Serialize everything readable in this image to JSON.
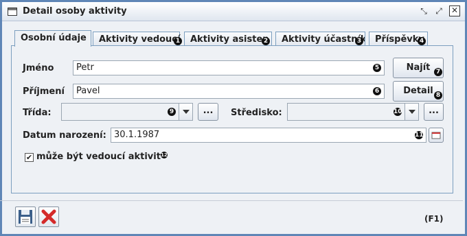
{
  "window": {
    "title": "Detail osoby aktivity",
    "minimize_glyph": "⤡",
    "maximize_glyph": "⤢",
    "close_glyph": "✕"
  },
  "tabs": [
    {
      "label": "Osobní údaje",
      "badge": ""
    },
    {
      "label": "Aktivity vedoucí",
      "badge": "1"
    },
    {
      "label": "Aktivity asisten",
      "badge": "2"
    },
    {
      "label": "Aktivity účastník",
      "badge": "3"
    },
    {
      "label": "Příspěvky",
      "badge": "4"
    }
  ],
  "form": {
    "jmeno_label": "Jméno",
    "jmeno_value": "Petr",
    "jmeno_badge": "5",
    "najit_label": "Najít",
    "najit_badge": "7",
    "prijmeni_label": "Příjmení",
    "prijmeni_value": "Pavel",
    "prijmeni_badge": "6",
    "detail_label": "Detail",
    "detail_badge": "8",
    "trida_label": "Třída:",
    "trida_badge": "9",
    "trida_more": "...",
    "stredisko_label": "Středisko:",
    "stredisko_badge": "10",
    "stredisko_more": "...",
    "datum_label": "Datum narození:",
    "datum_value": "30.1.1987",
    "datum_badge": "11",
    "checkbox_checked": "✔",
    "checkbox_label": "může být vedoucí aktivit",
    "checkbox_badge": "12"
  },
  "footer": {
    "save_icon": "save-icon",
    "cancel_icon": "cancel-icon",
    "help": "(F1)"
  }
}
